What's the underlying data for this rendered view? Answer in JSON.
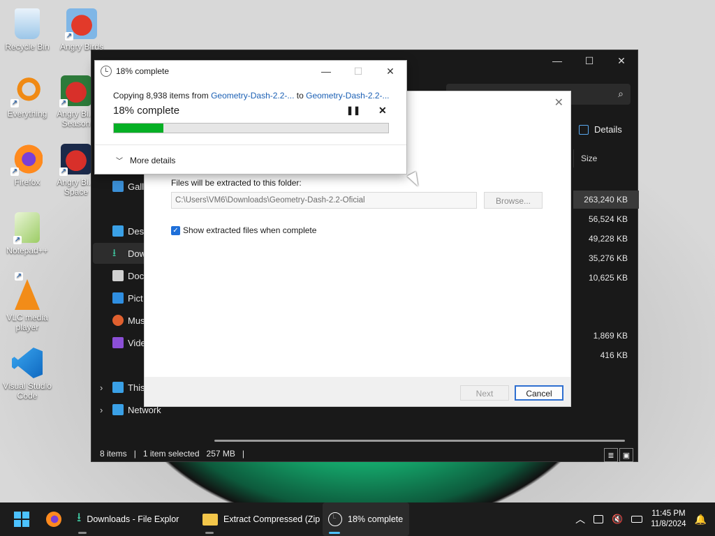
{
  "desktop": {
    "icons": [
      {
        "label": "Recycle Bin",
        "icon": "recycle-bin-icon"
      },
      {
        "label": "Angry Birds",
        "icon": "angry-birds-icon"
      },
      {
        "label": "Everything",
        "icon": "everything-search-icon"
      },
      {
        "label": "Angry Bi... Season",
        "icon": "angry-birds-seasons-icon"
      },
      {
        "label": "Firefox",
        "icon": "firefox-icon"
      },
      {
        "label": "Angry Bi... Space",
        "icon": "angry-birds-space-icon"
      },
      {
        "label": "Notepad++",
        "icon": "notepad-plus-plus-icon"
      },
      {
        "label": "VLC media player",
        "icon": "vlc-icon"
      },
      {
        "label": "Visual Studio Code",
        "icon": "vscode-icon"
      }
    ]
  },
  "explorer": {
    "details_label": "Details",
    "size_header": "Size",
    "sidebar": [
      "Gall",
      "Desk",
      "Dow",
      "Doc",
      "Pict",
      "Mus",
      "Vide",
      "This",
      "Network"
    ],
    "sizes": [
      "263,240 KB",
      "56,524 KB",
      "49,228 KB",
      "35,276 KB",
      "10,625 KB",
      "1,869 KB",
      "416 KB"
    ],
    "status": {
      "items": "8 items",
      "selected": "1 item selected",
      "size": "257 MB"
    }
  },
  "wizard": {
    "folder_label": "Files will be extracted to this folder:",
    "path": "C:\\Users\\VM6\\Downloads\\Geometry-Dash-2.2-Oficial",
    "browse_label": "Browse...",
    "show_files_label": "Show extracted files when complete",
    "next_label": "Next",
    "cancel_label": "Cancel"
  },
  "copy_dialog": {
    "title": "18% complete",
    "prefix": "Copying 8,938 items from ",
    "source": "Geometry-Dash-2.2-...",
    "to_word": " to ",
    "destination": "Geometry-Dash-2.2-...",
    "percent_text": "18% complete",
    "progress": 0.18,
    "more_details_label": "More details"
  },
  "taskbar": {
    "items": [
      {
        "label": "Downloads - File Explor",
        "icon": "download-folder-icon"
      },
      {
        "label": "Extract Compressed (Zip",
        "icon": "zip-folder-icon"
      },
      {
        "label": "18% complete",
        "icon": "copy-progress-icon"
      }
    ],
    "time": "11:45 PM",
    "date": "11/8/2024"
  },
  "colors": {
    "progress": "#06b025",
    "accent": "#1e6fd9",
    "link": "#1a5fb4"
  }
}
